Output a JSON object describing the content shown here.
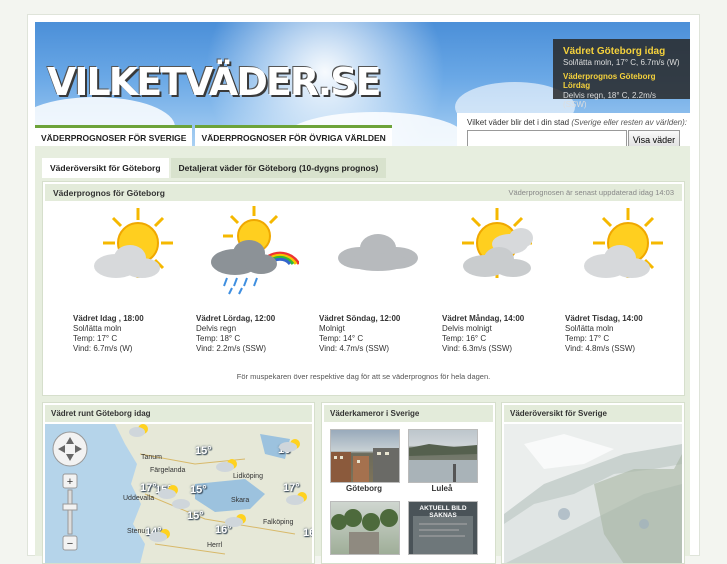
{
  "header": {
    "logo": "VILKETVÄDER.SE",
    "nav": [
      "VÄDERPROGNOSER FÖR SVERIGE",
      "VÄDERPROGNOSER FÖR ÖVRIGA VÄRLDEN"
    ]
  },
  "info_box": {
    "title": "Vädret Göteborg idag",
    "current": "Sol/lätta moln, 17° C, 6.7m/s (W)",
    "tomorrow_title": "Väderprognos Göteborg Lördag",
    "tomorrow": "Delvis regn, 18° C, 2.2m/s (SSW)"
  },
  "search": {
    "label": "Vilket väder blir det i din stad",
    "label_hint": "(Sverige eller resten av världen):",
    "value": "",
    "button": "Visa väder"
  },
  "tabs": [
    "Väderöversikt för Göteborg",
    "Detaljerat väder för Göteborg (10-dygns prognos)"
  ],
  "forecast": {
    "title": "Väderprognos för Göteborg",
    "updated": "Väderprognosen är senast uppdaterad idag 14:03",
    "days": [
      {
        "heading": "Vädret Idag , 18:00",
        "cond": "Sol/lätta moln",
        "temp": "Temp: 17° C",
        "wind": "Vind: 6.7m/s (W)",
        "icon": "sun-cloud-icon"
      },
      {
        "heading": "Vädret Lördag, 12:00",
        "cond": "Delvis regn",
        "temp": "Temp: 18° C",
        "wind": "Vind: 2.2m/s (SSW)",
        "icon": "rain-rainbow-icon"
      },
      {
        "heading": "Vädret Söndag, 12:00",
        "cond": "Molnigt",
        "temp": "Temp: 14° C",
        "wind": "Vind: 4.7m/s (SSW)",
        "icon": "cloud-icon"
      },
      {
        "heading": "Vädret Måndag, 14:00",
        "cond": "Delvis molnigt",
        "temp": "Temp: 16° C",
        "wind": "Vind: 6.3m/s (SSW)",
        "icon": "sun-clouds-icon"
      },
      {
        "heading": "Vädret Tisdag, 14:00",
        "cond": "Sol/lätta moln",
        "temp": "Temp: 17° C",
        "wind": "Vind: 4.8m/s (SSW)",
        "icon": "sun-cloud-icon"
      }
    ],
    "hint": "För muspekaren över respektive dag för att se väderprognos för hela dagen."
  },
  "panels": {
    "map_title": "Vädret runt Göteborg idag",
    "map_labels": [
      "Tanum",
      "Färgelanda",
      "Uddevalla",
      "Lidköping",
      "Skara",
      "Falköping",
      "Stenu",
      "Herrl"
    ],
    "map_temps": [
      "15°",
      "15°",
      "17°",
      "15°",
      "16°",
      "17°",
      "16°",
      "14°",
      "16°",
      "15°"
    ],
    "cams_title": "Väderkameror i Sverige",
    "cams": [
      "Göteborg",
      "Luleå"
    ],
    "cam_sign": "AKTUELL BILD SAKNAS",
    "overview_title": "Väderöversikt för Sverige"
  }
}
